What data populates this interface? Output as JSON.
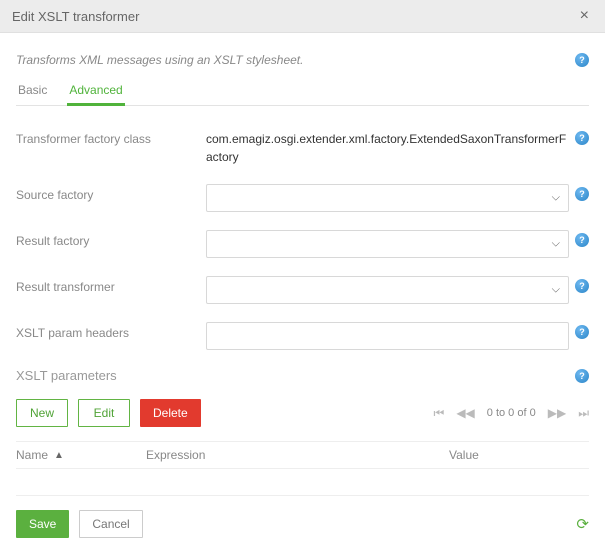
{
  "dialog": {
    "title": "Edit XSLT transformer",
    "description": "Transforms XML messages using an XSLT stylesheet."
  },
  "help_glyph": "?",
  "tabs": {
    "basic": "Basic",
    "advanced": "Advanced"
  },
  "fields": {
    "transformer_factory_class": {
      "label": "Transformer factory class",
      "value": "com.emagiz.osgi.extender.xml.factory.ExtendedSaxonTransformerFactory"
    },
    "source_factory": {
      "label": "Source factory",
      "value": ""
    },
    "result_factory": {
      "label": "Result factory",
      "value": ""
    },
    "result_transformer": {
      "label": "Result transformer",
      "value": ""
    },
    "xslt_param_headers": {
      "label": "XSLT param headers",
      "value": ""
    }
  },
  "params_section": {
    "title": "XSLT parameters",
    "buttons": {
      "new": "New",
      "edit": "Edit",
      "delete": "Delete"
    },
    "pager": "0 to 0 of 0",
    "columns": {
      "name": "Name",
      "expression": "Expression",
      "value": "Value"
    }
  },
  "footer": {
    "save": "Save",
    "cancel": "Cancel"
  }
}
